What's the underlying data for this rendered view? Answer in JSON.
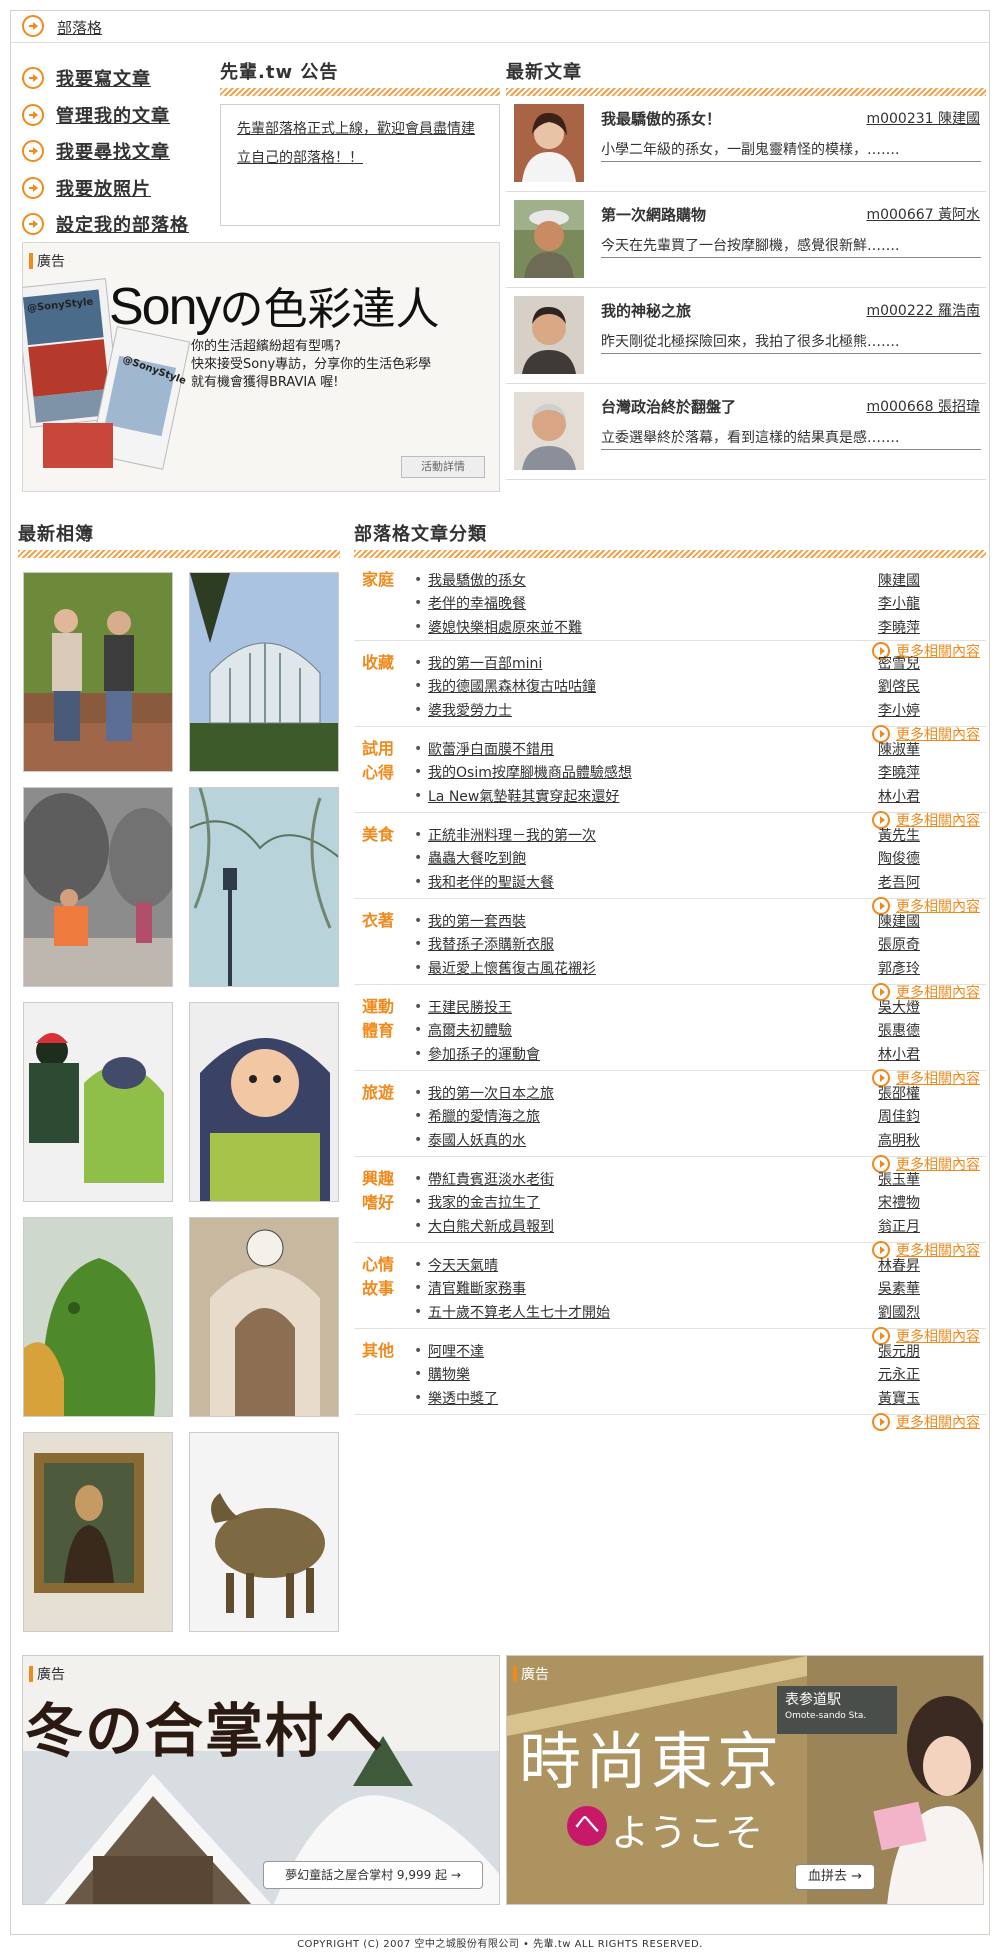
{
  "breadcrumb": {
    "label": "部落格"
  },
  "nav": {
    "items": [
      {
        "label": "我要寫文章"
      },
      {
        "label": "管理我的文章"
      },
      {
        "label": "我要尋找文章"
      },
      {
        "label": "我要放照片"
      },
      {
        "label": "設定我的部落格"
      }
    ]
  },
  "notice": {
    "title": "先輩.tw 公告",
    "text": "先輩部落格正式上線，歡迎會員盡情建立自己的部落格！！"
  },
  "ad_top": {
    "label": "廣告",
    "headline_latin": "Sony",
    "headline_cjk": "の色彩達人",
    "copy_lines": [
      "你的生活超繽紛超有型嗎?",
      "快來接受Sony專訪，分享你的生活色彩學",
      "就有機會獲得BRAVIA 喔!"
    ],
    "tag1": "@SonyStyle",
    "tag2": "@SonyStyle",
    "button": "活動詳情"
  },
  "latest": {
    "title": "最新文章",
    "articles": [
      {
        "title": "我最驕傲的孫女！",
        "author": "m000231 陳建國",
        "excerpt": "小學二年級的孫女，一副鬼靈精怪的模樣，……."
      },
      {
        "title": "第一次網路購物",
        "author": "m000667 黃阿水",
        "excerpt": "今天在先輩買了一台按摩腳機，感覺很新鮮……."
      },
      {
        "title": "我的神秘之旅",
        "author": "m000222 羅浩南",
        "excerpt": "昨天剛從北極探險回來，我拍了很多北極熊……."
      },
      {
        "title": "台灣政治終於翻盤了",
        "author": "m000668 張招瑋",
        "excerpt": "立委選舉終於落幕，看到這樣的結果真是感……."
      }
    ]
  },
  "albums": {
    "title": "最新相簿"
  },
  "categories": {
    "title": "部落格文章分類",
    "more_label": "更多相關內容",
    "list": [
      {
        "name": "家庭",
        "items": [
          [
            "我最驕傲的孫女",
            "陳建國"
          ],
          [
            "老伴的幸福晚餐",
            "李小龍"
          ],
          [
            "婆媳快樂相處原來並不難",
            "李曉萍"
          ]
        ]
      },
      {
        "name": "收藏",
        "items": [
          [
            "我的第一百部mini",
            "密雪兒"
          ],
          [
            "我的德國黑森林復古咕咕鐘",
            "劉啓民"
          ],
          [
            "婆我愛勞力士",
            "李小婷"
          ]
        ]
      },
      {
        "name": "試用心得",
        "items": [
          [
            "歐蕾淨白面膜不錯用",
            "陳淑華"
          ],
          [
            "我的Osim按摩腳機商品體驗感想",
            "李曉萍"
          ],
          [
            "La New氣墊鞋其實穿起來還好",
            "林小君"
          ]
        ]
      },
      {
        "name": "美食",
        "items": [
          [
            "正統非洲料理－我的第一次",
            "黃先生"
          ],
          [
            "蟲蟲大餐吃到飽",
            "陶俊德"
          ],
          [
            "我和老伴的聖誕大餐",
            "老吾阿"
          ]
        ]
      },
      {
        "name": "衣著",
        "items": [
          [
            "我的第一套西裝",
            "陳建國"
          ],
          [
            "我替孫子添購新衣服",
            "張原奇"
          ],
          [
            "最近愛上懷舊復古風花襯衫",
            "郭彥玲"
          ]
        ]
      },
      {
        "name": "運動體育",
        "items": [
          [
            "王建民勝投王",
            "吳大燈"
          ],
          [
            "高爾夫初體驗",
            "張惠德"
          ],
          [
            "參加孫子的運動會",
            "林小君"
          ]
        ]
      },
      {
        "name": "旅遊",
        "items": [
          [
            "我的第一次日本之旅",
            "張邵權"
          ],
          [
            "希臘的愛情海之旅",
            "周佳鈞"
          ],
          [
            "泰國人妖真的水",
            "高明秋"
          ]
        ]
      },
      {
        "name": "興趣嗜好",
        "items": [
          [
            "帶紅貴賓逛淡水老街",
            "張玉華"
          ],
          [
            "我家的金吉拉生了",
            "宋禮物"
          ],
          [
            "大白熊犬新成員報到",
            "翁正月"
          ]
        ]
      },
      {
        "name": "心情故事",
        "items": [
          [
            "今天天氣晴",
            "林春昇"
          ],
          [
            "清官難斷家務事",
            "吳素華"
          ],
          [
            "五十歲不算老人生七十才開始",
            "劉國烈"
          ]
        ]
      },
      {
        "name": "其他",
        "items": [
          [
            "阿哩不達",
            "張元朋"
          ],
          [
            "購物樂",
            "元永正"
          ],
          [
            "樂透中獎了",
            "黃寶玉"
          ]
        ]
      }
    ]
  },
  "ad_bottom_left": {
    "label": "廣告",
    "headline": "冬の合掌村へ",
    "button": "夢幻童話之屋合掌村 9,999 起 →"
  },
  "ad_bottom_right": {
    "label": "廣告",
    "headline": "時尚東京",
    "sub": "ようこそ",
    "he": "へ",
    "station": "表参道駅",
    "station_latin": "Omote-sando Sta.",
    "button": "血拼去 →"
  },
  "footer": {
    "text": "COPYRIGHT (C) 2007 空中之城股份有限公司 • 先輩.tw  ALL RIGHTS RESERVED."
  },
  "colors": {
    "accent": "#f08a1c",
    "border": "#d8d2c6"
  }
}
